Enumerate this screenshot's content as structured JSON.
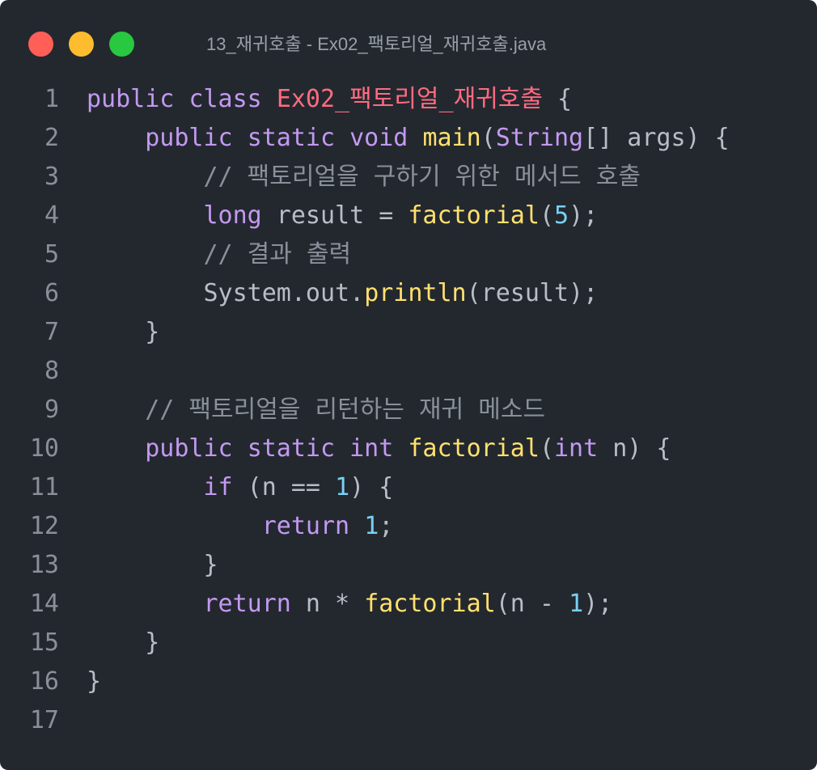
{
  "window": {
    "title": "13_재귀호출 - Ex02_팩토리얼_재귀호출.java"
  },
  "colors": {
    "background": "#23282f",
    "keyword": "#c399f0",
    "function": "#ffe16e",
    "class_name": "#ff6b80",
    "number": "#78d1f2",
    "comment": "#8a9099",
    "text": "#b8bec6"
  },
  "editor": {
    "line_numbers": [
      "1",
      "2",
      "3",
      "4",
      "5",
      "6",
      "7",
      "8",
      "9",
      "10",
      "11",
      "12",
      "13",
      "14",
      "15",
      "16",
      "17"
    ],
    "lines": [
      [
        [
          "public",
          "kw"
        ],
        [
          " ",
          "pl"
        ],
        [
          "class",
          "kw"
        ],
        [
          " ",
          "pl"
        ],
        [
          "Ex02_팩토리얼_재귀호출",
          "cls"
        ],
        [
          " {",
          "pl"
        ]
      ],
      [
        [
          "    ",
          "pl"
        ],
        [
          "public",
          "kw"
        ],
        [
          " ",
          "pl"
        ],
        [
          "static",
          "kw"
        ],
        [
          " ",
          "pl"
        ],
        [
          "void",
          "kw"
        ],
        [
          " ",
          "pl"
        ],
        [
          "main",
          "fn"
        ],
        [
          "(",
          "pl"
        ],
        [
          "String",
          "kw"
        ],
        [
          "[] args) {",
          "pl"
        ]
      ],
      [
        [
          "        ",
          "pl"
        ],
        [
          "// 팩토리얼을 구하기 위한 메서드 호출",
          "cm"
        ]
      ],
      [
        [
          "        ",
          "pl"
        ],
        [
          "long",
          "kw"
        ],
        [
          " result = ",
          "pl"
        ],
        [
          "factorial",
          "fn"
        ],
        [
          "(",
          "pl"
        ],
        [
          "5",
          "num"
        ],
        [
          ");",
          "pl"
        ]
      ],
      [
        [
          "        ",
          "pl"
        ],
        [
          "// 결과 출력",
          "cm"
        ]
      ],
      [
        [
          "        ",
          "pl"
        ],
        [
          "System.out.",
          "pl"
        ],
        [
          "println",
          "fn"
        ],
        [
          "(result);",
          "pl"
        ]
      ],
      [
        [
          "    }",
          "pl"
        ]
      ],
      [],
      [
        [
          "    ",
          "pl"
        ],
        [
          "// 팩토리얼을 리턴하는 재귀 메소드",
          "cm"
        ]
      ],
      [
        [
          "    ",
          "pl"
        ],
        [
          "public",
          "kw"
        ],
        [
          " ",
          "pl"
        ],
        [
          "static",
          "kw"
        ],
        [
          " ",
          "pl"
        ],
        [
          "int",
          "kw"
        ],
        [
          " ",
          "pl"
        ],
        [
          "factorial",
          "fn"
        ],
        [
          "(",
          "pl"
        ],
        [
          "int",
          "kw"
        ],
        [
          " n) {",
          "pl"
        ]
      ],
      [
        [
          "        ",
          "pl"
        ],
        [
          "if",
          "kw"
        ],
        [
          " (n == ",
          "pl"
        ],
        [
          "1",
          "num"
        ],
        [
          ") {",
          "pl"
        ]
      ],
      [
        [
          "            ",
          "pl"
        ],
        [
          "return",
          "kw"
        ],
        [
          " ",
          "pl"
        ],
        [
          "1",
          "num"
        ],
        [
          ";",
          "pl"
        ]
      ],
      [
        [
          "        }",
          "pl"
        ]
      ],
      [
        [
          "        ",
          "pl"
        ],
        [
          "return",
          "kw"
        ],
        [
          " n * ",
          "pl"
        ],
        [
          "factorial",
          "fn"
        ],
        [
          "(n - ",
          "pl"
        ],
        [
          "1",
          "num"
        ],
        [
          ");",
          "pl"
        ]
      ],
      [
        [
          "    }",
          "pl"
        ]
      ],
      [
        [
          "}",
          "pl"
        ]
      ],
      []
    ]
  }
}
